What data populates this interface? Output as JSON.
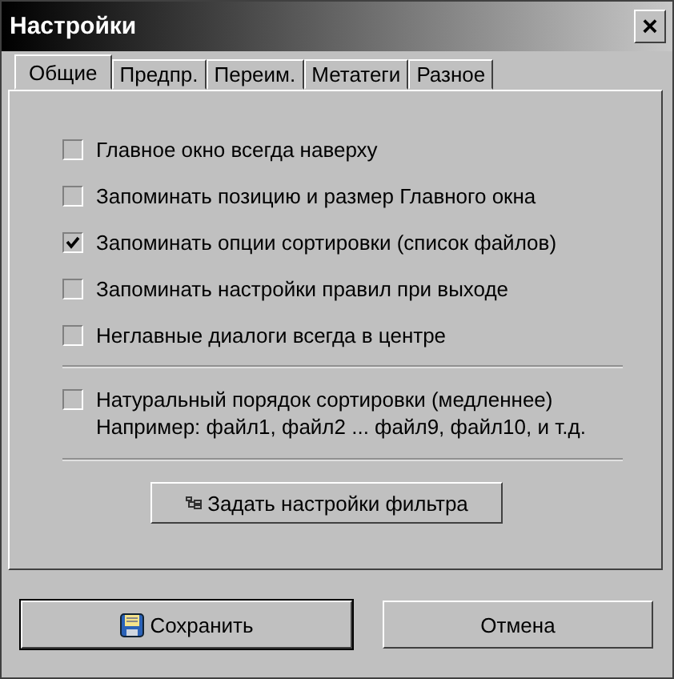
{
  "window": {
    "title": "Настройки",
    "close": "×"
  },
  "tabs": [
    {
      "label": "Общие",
      "selected": true
    },
    {
      "label": "Предпр.",
      "selected": false
    },
    {
      "label": "Переим.",
      "selected": false
    },
    {
      "label": "Метатеги",
      "selected": false
    },
    {
      "label": "Разное",
      "selected": false
    }
  ],
  "options": [
    {
      "label": "Главное окно всегда наверху",
      "checked": false
    },
    {
      "label": "Запоминать позицию и размер Главного окна",
      "checked": false
    },
    {
      "label": "Запоминать опции сортировки (список файлов)",
      "checked": true
    },
    {
      "label": "Запоминать настройки правил при выходе",
      "checked": false
    },
    {
      "label": "Неглавные диалоги всегда в центре",
      "checked": false
    }
  ],
  "sort_option": {
    "label": "Натуральный порядок сортировки (медленнее)",
    "note": "Например: файл1, файл2 ... файл9, файл10, и т.д.",
    "checked": false
  },
  "filter_button": "Задать настройки фильтра",
  "buttons": [
    {
      "label": "Сохранить",
      "kind": "save"
    },
    {
      "label": "Отмена",
      "kind": "cancel"
    }
  ]
}
